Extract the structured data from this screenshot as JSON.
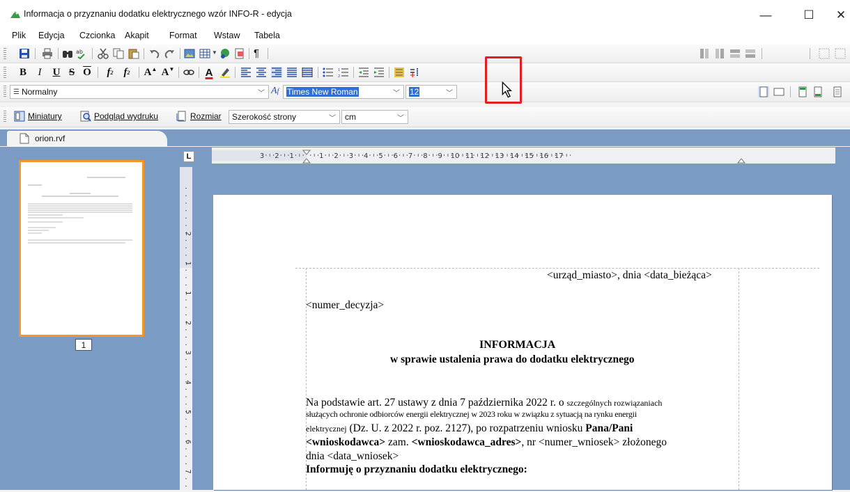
{
  "window": {
    "title": "Informacja o przyznaniu dodatku elektrycznego wzór INFO-R - edycja",
    "minimize": "—",
    "maximize": "☐",
    "close": "✕"
  },
  "menu": [
    "Plik",
    "Edycja",
    "Czcionka",
    "Akapit",
    "Format",
    "Wstaw",
    "Tabela"
  ],
  "format_toolbar": {
    "bold": "B",
    "italic": "I",
    "underline": "U",
    "strike": "S",
    "overline": "O",
    "subscript_label": "f",
    "subscript_mark": "2",
    "superscript_label": "f",
    "superscript_mark": "2",
    "grow_font": "A",
    "shrink_font": "A",
    "font_color": "A"
  },
  "style_toolbar": {
    "style_value": "Normalny",
    "font_value": "Times New Roman",
    "size_value": "12"
  },
  "view_toolbar": {
    "thumbnails_label": "Miniatury",
    "preview_label": "Podgląd wydruku",
    "size_label": "Rozmiar",
    "zoom_value": "Szerokość strony",
    "unit_value": "cm"
  },
  "tab": {
    "name": "orion.rvf"
  },
  "thumbnail": {
    "page_number": "1"
  },
  "ruler": {
    "h_labels": [
      "3",
      "2",
      "1",
      "1",
      "2",
      "3",
      "4",
      "5",
      "6",
      "7",
      "8",
      "9",
      "10",
      "11",
      "12",
      "13",
      "14",
      "15",
      "16",
      "17"
    ],
    "v_labels": [
      "2",
      "1",
      "1",
      "2",
      "3",
      "4",
      "5",
      "6",
      "7"
    ],
    "corner": "L"
  },
  "document": {
    "line1": "<urząd_miasto>, dnia <data_bieżąca>",
    "line2": "<numer_decyzja>",
    "heading1": "INFORMACJA",
    "heading2": "w sprawie ustalenia prawa do dodatku elektrycznego",
    "para1_a": "Na podstawie art. 27 ustawy z dnia 7 października 2022 r. o ",
    "para1_b": "szczególnych rozwiązaniach",
    "para2": "służących ochronie odbiorców energii elektrycznej w 2023 roku w związku z sytuacją na rynku energii",
    "para3_a": "elektrycznej",
    "para3_b": " (Dz. U. z 2022 r. poz. 2127), po rozpatrzeniu wniosku  ",
    "para3_c": "Pana/Pani",
    "para4_a": "<wnioskodawca>",
    "para4_b": " zam. ",
    "para4_c": "<wnioskodawca_adres>",
    "para4_d": ", nr <numer_wniosek> złożonego",
    "para5": "dnia <data_wniosek>",
    "para6": "Informuję o przyznaniu dodatku elektrycznego:"
  }
}
